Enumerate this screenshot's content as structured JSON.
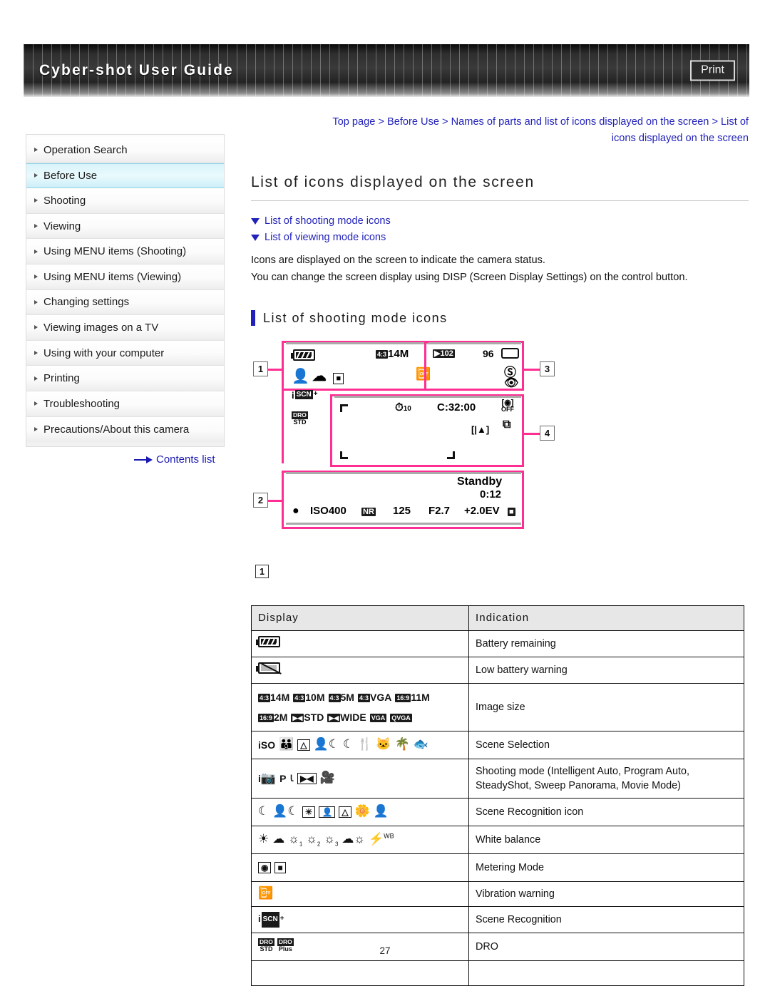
{
  "header": {
    "title": "Cyber-shot User Guide",
    "print_label": "Print"
  },
  "sidebar": {
    "items": [
      {
        "label": "Operation Search",
        "active": false
      },
      {
        "label": "Before Use",
        "active": true
      },
      {
        "label": "Shooting",
        "active": false
      },
      {
        "label": "Viewing",
        "active": false
      },
      {
        "label": "Using MENU items (Shooting)",
        "active": false
      },
      {
        "label": "Using MENU items (Viewing)",
        "active": false
      },
      {
        "label": "Changing settings",
        "active": false
      },
      {
        "label": "Viewing images on a TV",
        "active": false
      },
      {
        "label": "Using with your computer",
        "active": false
      },
      {
        "label": "Printing",
        "active": false
      },
      {
        "label": "Troubleshooting",
        "active": false
      },
      {
        "label": "Precautions/About this camera",
        "active": false
      }
    ],
    "contents_link": "Contents list"
  },
  "main": {
    "breadcrumb_line1": "Top page > Before Use > Names of parts and list of icons displayed on the screen > List of",
    "breadcrumb_line2": "icons displayed on the screen",
    "page_title": "List of icons displayed on the screen",
    "jump_links": [
      "List of shooting mode icons",
      "List of viewing mode icons"
    ],
    "intro_line1": "Icons are displayed on the screen to indicate the camera status.",
    "intro_line2": "You can change the screen display using DISP (Screen Display Settings) on the control button.",
    "section_heading": "List of shooting mode icons",
    "mark_label": "1"
  },
  "diagram": {
    "callouts": [
      "1",
      "3",
      "4",
      "2"
    ],
    "region1": {
      "image_size": "14M",
      "aspect_badge": "4:3",
      "iscn_i": "i",
      "iscn_scn": "SCN",
      "iscn_plus": "+",
      "dro_top": "DRO",
      "dro_bottom": "STD"
    },
    "region3": {
      "folder": "102",
      "shots_remaining": "96"
    },
    "region4": {
      "self_timer": "10",
      "rec_time": "C:32:00",
      "face_off": "OFF"
    },
    "region2": {
      "standby": "Standby",
      "time": "0:12",
      "iso": "ISO400",
      "nr": "NR",
      "shutter": "125",
      "aperture": "F2.7",
      "ev": "+2.0EV"
    }
  },
  "table": {
    "headers": [
      "Display",
      "Indication"
    ],
    "rows": [
      {
        "display_kind": "battery",
        "indication": "Battery remaining"
      },
      {
        "display_kind": "battery-low",
        "indication": "Low battery warning"
      },
      {
        "display_kind": "image-size",
        "items_line1": [
          {
            "badge": "4:3",
            "label": "14M"
          },
          {
            "badge": "4:3",
            "label": "10M"
          },
          {
            "badge": "4:3",
            "label": "5M"
          },
          {
            "badge": "4:3",
            "label": "VGA"
          },
          {
            "badge": "16:9",
            "label": "11M"
          }
        ],
        "items_line2": [
          {
            "badge": "16:9",
            "label": "2M"
          },
          {
            "badge": "pano",
            "label": "STD"
          },
          {
            "badge": "pano",
            "label": "WIDE"
          },
          {
            "badge": "VGA",
            "label": ""
          },
          {
            "badge": "QVGA",
            "label": ""
          }
        ],
        "indication": "Image size"
      },
      {
        "display_kind": "scene-selection",
        "glyphs": [
          "ISO",
          "soft-skin",
          "landscape",
          "twilight-portrait",
          "twilight",
          "gourmet",
          "pet",
          "beach",
          "underwater"
        ],
        "indication": "Scene Selection"
      },
      {
        "display_kind": "shooting-mode",
        "glyphs": [
          "intelligent-auto",
          "program-auto",
          "steadyshot",
          "sweep-panorama",
          "movie-mode"
        ],
        "indication": "Shooting mode (Intelligent Auto, Program Auto, SteadyShot, Sweep Panorama, Movie Mode)"
      },
      {
        "display_kind": "scene-recognition-icons",
        "glyphs": [
          "twilight",
          "twilight-portrait",
          "backlight",
          "backlight-portrait",
          "landscape",
          "macro",
          "portrait"
        ],
        "indication": "Scene Recognition icon"
      },
      {
        "display_kind": "white-balance",
        "glyphs": [
          "daylight",
          "cloudy",
          "fluorescent-1",
          "fluorescent-2",
          "fluorescent-3",
          "incandescent",
          "flash-wb"
        ],
        "indication": "White balance"
      },
      {
        "display_kind": "metering",
        "glyphs": [
          "multi-metering",
          "spot-metering"
        ],
        "indication": "Metering Mode"
      },
      {
        "display_kind": "vibration",
        "indication": "Vibration warning"
      },
      {
        "display_kind": "scene-recognition",
        "indication": "Scene Recognition"
      },
      {
        "display_kind": "dro",
        "dro_items": [
          {
            "top": "DRO",
            "bottom": "STD"
          },
          {
            "top": "DRO",
            "bottom": "Plus"
          }
        ],
        "indication": "DRO"
      },
      {
        "display_kind": "empty",
        "indication": ""
      }
    ]
  },
  "footer": {
    "page_number": "27"
  }
}
